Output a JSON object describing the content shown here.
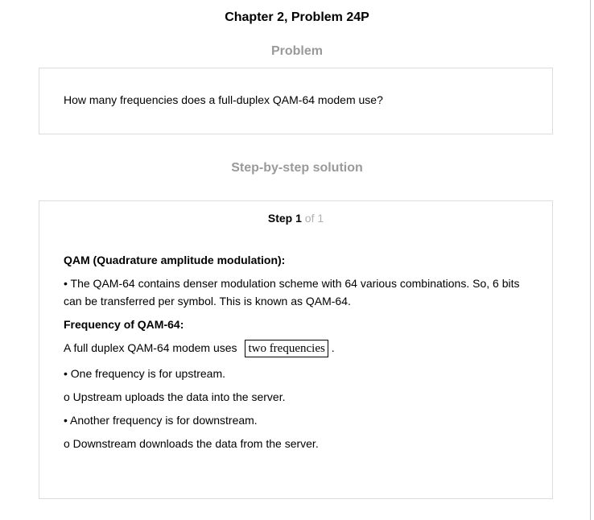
{
  "header": {
    "title": "Chapter 2, Problem 24P"
  },
  "problem": {
    "heading": "Problem",
    "text": "How many frequencies does a full-duplex QAM-64 modem use?"
  },
  "solution": {
    "heading": "Step-by-step solution",
    "step": {
      "word": "Step",
      "number": "1",
      "of_text": "of 1"
    },
    "qam_heading": "QAM (Quadrature amplitude modulation):",
    "qam_paragraph": "• The QAM-64 contains denser modulation scheme with 64 various combinations. So, 6 bits can be transferred per symbol. This is known as QAM-64.",
    "freq_heading": "Frequency of QAM-64:",
    "answer_prefix": "A full duplex QAM-64 modem uses",
    "answer_boxed": "two frequencies",
    "answer_suffix": ".",
    "bullets": [
      "• One frequency is for upstream.",
      "o Upstream uploads the data into the server.",
      "• Another frequency is for downstream.",
      "o Downstream downloads the data from the server."
    ]
  }
}
